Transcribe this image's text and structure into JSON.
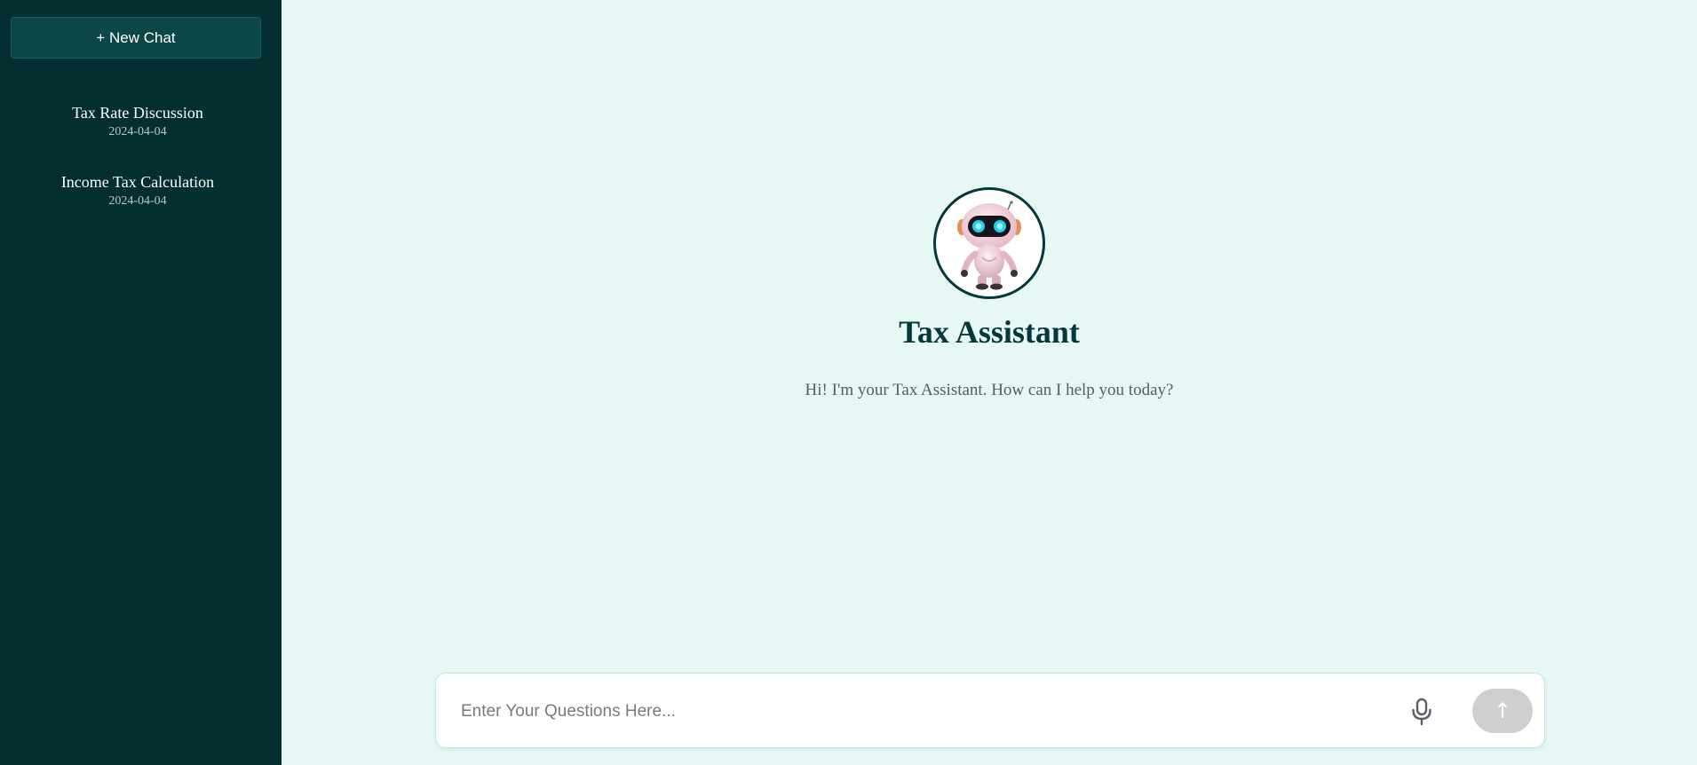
{
  "sidebar": {
    "new_chat_label": "+ New Chat",
    "history": [
      {
        "title": "Tax Rate Discussion",
        "date": "2024-04-04"
      },
      {
        "title": "Income Tax Calculation",
        "date": "2024-04-04"
      }
    ]
  },
  "hero": {
    "avatar_icon": "robot-icon",
    "title": "Tax Assistant",
    "subtitle": "Hi! I'm your Tax Assistant. How can I help you today?"
  },
  "composer": {
    "placeholder": "Enter Your Questions Here...",
    "mic_icon": "microphone-icon",
    "send_icon": "arrow-up-icon",
    "send_glyph": "↑"
  },
  "colors": {
    "sidebar_bg": "#042f31",
    "main_bg": "#e6f7f6",
    "accent": "#04383a",
    "send_button_disabled": "#cfcfcf"
  }
}
